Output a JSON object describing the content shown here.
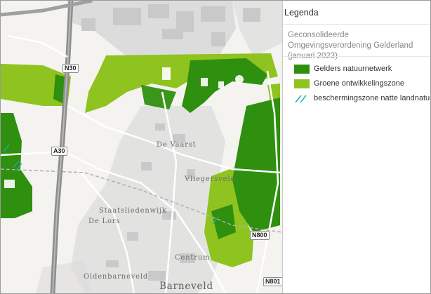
{
  "legend": {
    "title": "Legenda",
    "layer_title": "Geconsolideerde Omgevingsverordening Gelderland (januari 2023)",
    "items": [
      {
        "label": "Gelders natuurnetwerk",
        "color": "#2f8f0f",
        "symbol": "fill"
      },
      {
        "label": "Groene ontwikkelingszone",
        "color": "#8fc31f",
        "symbol": "fill"
      },
      {
        "label": "beschermingszone natte landnatuur",
        "color": "#19b3a6",
        "symbol": "hatch"
      }
    ]
  },
  "map": {
    "place_labels": [
      "De Vaarst",
      "Vliegersveld",
      "Staatsliedenwijk",
      "De Lors",
      "Centrum",
      "Oldenbarneveld",
      "Barneveld"
    ],
    "road_labels": [
      "N30",
      "A30",
      "N800",
      "N801"
    ],
    "colors": {
      "background": "#f4f3f0",
      "motorway": "#8e8e8e",
      "road": "#ffffff",
      "built_up": "#d8d8d8",
      "natuurnetwerk": "#2f8f0f",
      "ontwikkelingszone": "#8fc31f"
    }
  }
}
